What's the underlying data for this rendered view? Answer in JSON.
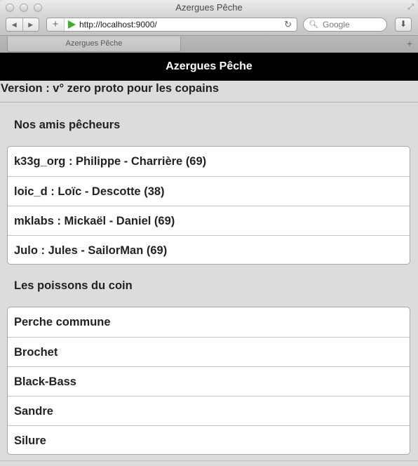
{
  "window": {
    "title": "Azergues Pêche",
    "url": "http://localhost:9000/",
    "search_placeholder": "Google",
    "tab_label": "Azergues Pêche"
  },
  "app": {
    "header_title": "Azergues Pêche",
    "version_text": "Version : v° zero proto pour les copains",
    "friends_title": "Nos amis pêcheurs",
    "friends": [
      "k33g_org : Philippe - Charrière (69)",
      "loic_d : Loïc - Descotte (38)",
      "mklabs : Mickaël - Daniel (69)",
      "Julo : Jules - SailorMan (69)"
    ],
    "fish_title": "Les poissons du coin",
    "fish": [
      "Perche commune",
      "Brochet",
      "Black-Bass",
      "Sandre",
      "Silure"
    ]
  },
  "icons": {
    "back": "back-arrow-icon",
    "forward": "forward-arrow-icon",
    "add_bookmark": "plus-icon",
    "go": "play-icon",
    "reload": "reload-icon",
    "search": "magnifier-icon",
    "downloads": "download-icon",
    "new_tab": "plus-icon"
  },
  "colors": {
    "header_bg": "#000000",
    "page_bg": "#dcdcdc",
    "go_icon": "#3fae2a"
  }
}
